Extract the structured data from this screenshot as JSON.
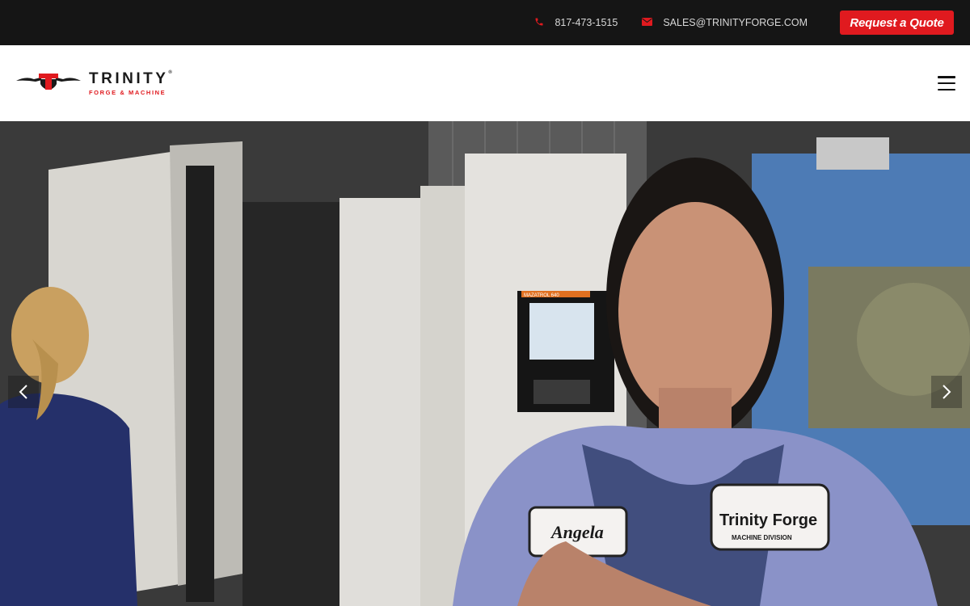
{
  "topbar": {
    "phone": "817-473-1515",
    "email": "SALES@TRINITYFORGE.COM",
    "quote_label": "Request a Quote"
  },
  "header": {
    "brand_name": "TRINITY",
    "brand_mark": "®",
    "brand_tagline": "FORGE & MACHINE",
    "menu_icon": "hamburger-menu-icon"
  },
  "hero": {
    "machine_panel_label": "MAZATROL 640",
    "shirt_patch_left": "Angela",
    "shirt_patch_right": "Trinity Forge",
    "shirt_patch_right_sub": "MACHINE DIVISION",
    "prev_icon": "chevron-left-icon",
    "next_icon": "chevron-right-icon"
  },
  "colors": {
    "accent_red": "#e01a1f",
    "topbar_bg": "#151515",
    "header_bg": "#ffffff"
  }
}
